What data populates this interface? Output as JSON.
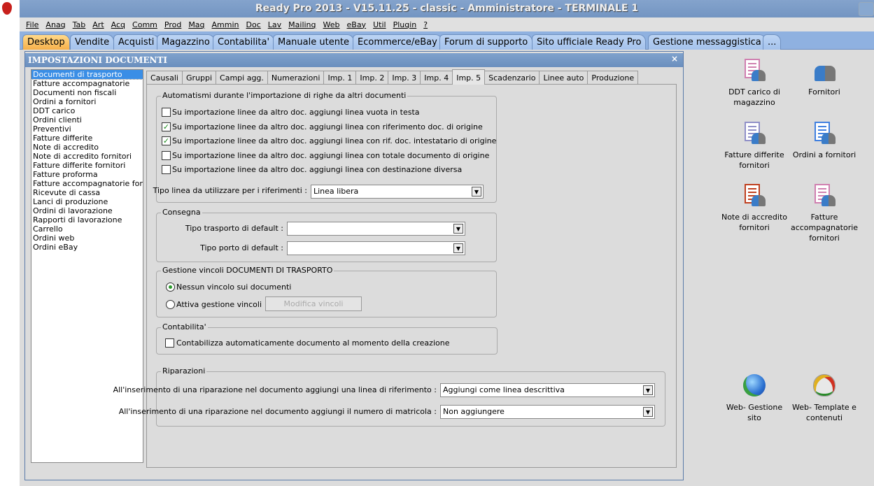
{
  "window": {
    "title": "Ready Pro 2013 - V15.11.25 - classic - Amministratore - TERMINALE 1"
  },
  "menu": [
    "File",
    "Anag",
    "Tab",
    "Art",
    "Acq",
    "Comm",
    "Prod",
    "Mag",
    "Ammin",
    "Doc",
    "Lav",
    "Mailing",
    "Web",
    "eBay",
    "Util",
    "Plugin",
    "?"
  ],
  "desktop_tabs": [
    "Desktop",
    "Vendite",
    "Acquisti",
    "Magazzino",
    "Contabilita'",
    "Manuale utente",
    "Ecommerce/eBay",
    "Forum di supporto",
    "Sito ufficiale Ready Pro",
    "Gestione messaggistica",
    "..."
  ],
  "dialog": {
    "title": "IMPOSTAZIONI DOCUMENTI",
    "close": "×",
    "documents": [
      "Documenti di trasporto",
      "Fatture accompagnatorie",
      "Documenti non fiscali",
      "Ordini a fornitori",
      "DDT carico",
      "Ordini clienti",
      "Preventivi",
      "Fatture differite",
      "Note di accredito",
      "Note di accredito fornitori",
      "Fatture differite fornitori",
      "Fatture proforma",
      "Fatture accompagnatorie fornitori",
      "Ricevute di cassa",
      "Lanci di produzione",
      "Ordini di lavorazione",
      "Rapporti di lavorazione",
      "Carrello",
      "Ordini web",
      "Ordini eBay"
    ],
    "tabs": [
      "Causali",
      "Gruppi",
      "Campi agg.",
      "Numerazioni",
      "Imp. 1",
      "Imp. 2",
      "Imp. 3",
      "Imp. 4",
      "Imp. 5",
      "Scadenzario",
      "Linee auto",
      "Produzione"
    ],
    "automatismi": {
      "legend": "Automatismi durante l'importazione di righe da altri documenti",
      "options": [
        {
          "label": "Su importazione linee da altro doc. aggiungi linea vuota in testa",
          "checked": false
        },
        {
          "label": "Su importazione linee da altro doc. aggiungi linea con riferimento doc. di origine",
          "checked": true
        },
        {
          "label": "Su importazione linee da altro doc. aggiungi linea con rif. doc. intestatario di origine",
          "checked": true
        },
        {
          "label": "Su importazione linee da altro doc. aggiungi linea con totale documento di origine",
          "checked": false
        },
        {
          "label": "Su importazione linee da altro doc. aggiungi linea con destinazione diversa",
          "checked": false
        }
      ],
      "tipo_linea_label": "Tipo linea da utilizzare per i riferimenti :",
      "tipo_linea_value": "Linea libera"
    },
    "consegna": {
      "legend": "Consegna",
      "trasporto_label": "Tipo trasporto di default :",
      "trasporto_value": "",
      "porto_label": "Tipo porto di default :",
      "porto_value": ""
    },
    "vincoli": {
      "legend": "Gestione vincoli DOCUMENTI DI TRASPORTO",
      "radio1": "Nessun vincolo sui documenti",
      "radio2": "Attiva gestione vincoli",
      "selected": 1,
      "button": "Modifica vincoli"
    },
    "contabilita": {
      "legend": "Contabilita'",
      "option": "Contabilizza automaticamente documento al momento della creazione",
      "checked": false
    },
    "riparazioni": {
      "legend": "Riparazioni",
      "linea_label": "All'inserimento di una riparazione nel documento aggiungi una linea di riferimento :",
      "linea_value": "Aggiungi come linea descrittiva",
      "matricola_label": "All'inserimento di una riparazione nel documento aggiungi il numero di matricola :",
      "matricola_value": "Non aggiungere"
    }
  },
  "desktop_icons": [
    {
      "label": "DDT carico di magazzino",
      "icon": "document-people-icon",
      "color": "#d080b0"
    },
    {
      "label": "Fornitori",
      "icon": "people-icon"
    },
    {
      "label": "Fatture differite fornitori",
      "icon": "document-people-icon",
      "color": "#9090c8"
    },
    {
      "label": "Ordini a fornitori",
      "icon": "document-people-icon",
      "color": "#4080e0"
    },
    {
      "label": "Note di accredito fornitori",
      "icon": "document-people-icon",
      "color": "#c04020"
    },
    {
      "label": "Fatture accompagnatorie fornitori",
      "icon": "document-people-icon",
      "color": "#d080b0"
    },
    {
      "label": "Web- Gestione sito",
      "icon": "globe-icon"
    },
    {
      "label": "Web- Template e contenuti",
      "icon": "palette-icon"
    }
  ]
}
